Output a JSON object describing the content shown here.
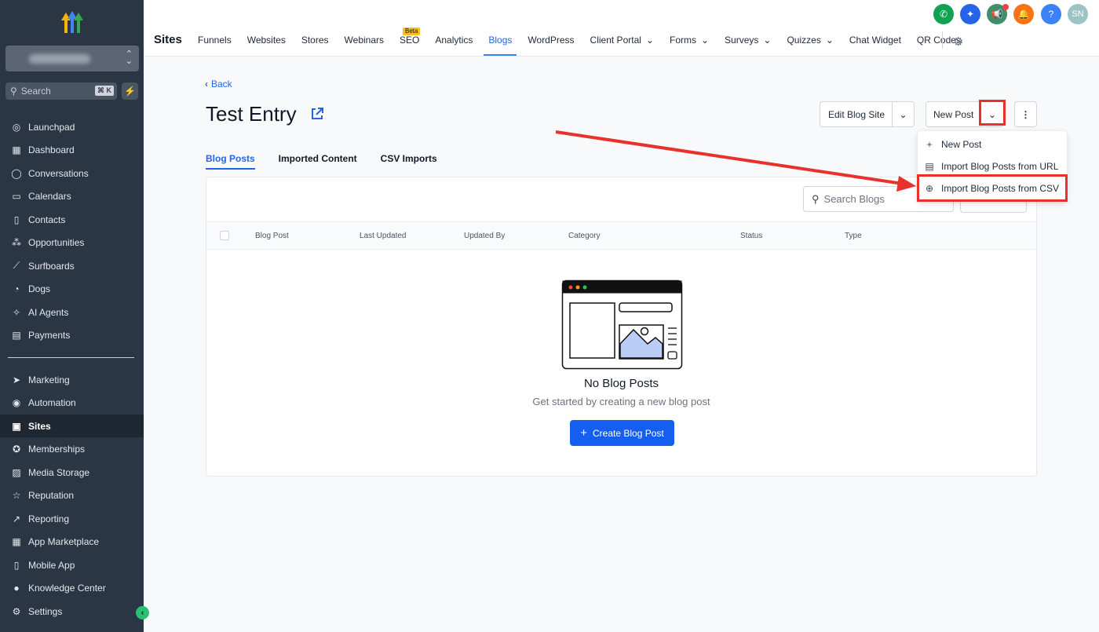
{
  "sidebar": {
    "search_placeholder": "Search",
    "search_shortcut": "⌘ K",
    "items_top": [
      {
        "label": "Launchpad",
        "icon": "launchpad-icon"
      },
      {
        "label": "Dashboard",
        "icon": "dashboard-icon"
      },
      {
        "label": "Conversations",
        "icon": "chat-icon"
      },
      {
        "label": "Calendars",
        "icon": "calendar-icon"
      },
      {
        "label": "Contacts",
        "icon": "contacts-icon"
      },
      {
        "label": "Opportunities",
        "icon": "opportunities-icon"
      },
      {
        "label": "Surfboards",
        "icon": "surfboard-icon"
      },
      {
        "label": "Dogs",
        "icon": "dog-icon"
      },
      {
        "label": "AI Agents",
        "icon": "sparkle-icon"
      },
      {
        "label": "Payments",
        "icon": "payments-icon"
      }
    ],
    "items_bottom": [
      {
        "label": "Marketing",
        "icon": "send-icon"
      },
      {
        "label": "Automation",
        "icon": "automation-icon"
      },
      {
        "label": "Sites",
        "icon": "sites-icon",
        "active": true
      },
      {
        "label": "Memberships",
        "icon": "badge-icon"
      },
      {
        "label": "Media Storage",
        "icon": "image-icon"
      },
      {
        "label": "Reputation",
        "icon": "star-icon"
      },
      {
        "label": "Reporting",
        "icon": "trend-icon"
      },
      {
        "label": "App Marketplace",
        "icon": "grid-icon"
      },
      {
        "label": "Mobile App",
        "icon": "phone-icon"
      },
      {
        "label": "Knowledge Center",
        "icon": "book-icon"
      }
    ],
    "settings_label": "Settings"
  },
  "topbar": {
    "title": "Sites",
    "tabs": [
      "Funnels",
      "Websites",
      "Stores",
      "Webinars",
      "SEO",
      "Analytics",
      "Blogs",
      "WordPress",
      "Client Portal",
      "Forms",
      "Surveys",
      "Quizzes",
      "Chat Widget",
      "QR Codes"
    ],
    "seo_badge": "Beta",
    "active_tab": "Blogs",
    "avatar_initials": "SN",
    "help_label": "?"
  },
  "page": {
    "back_label": "Back",
    "title": "Test Entry",
    "edit_site_label": "Edit Blog Site",
    "new_post_label": "New Post",
    "tabs": [
      "Blog Posts",
      "Imported Content",
      "CSV Imports"
    ],
    "search_placeholder": "Search Blogs",
    "columns": [
      "Blog Post",
      "Last Updated",
      "Updated By",
      "Category",
      "Status",
      "Type"
    ],
    "empty_title": "No Blog Posts",
    "empty_subtitle": "Get started by creating a new blog post",
    "create_label": "Create Blog Post"
  },
  "dropdown": {
    "items": [
      "New Post",
      "Import Blog Posts from URL",
      "Import Blog Posts from CSV"
    ]
  },
  "colors": {
    "sidebar_bg": "#2b3645",
    "accent": "#2563eb",
    "primary_button": "#155eef",
    "highlight": "#e8312a"
  }
}
